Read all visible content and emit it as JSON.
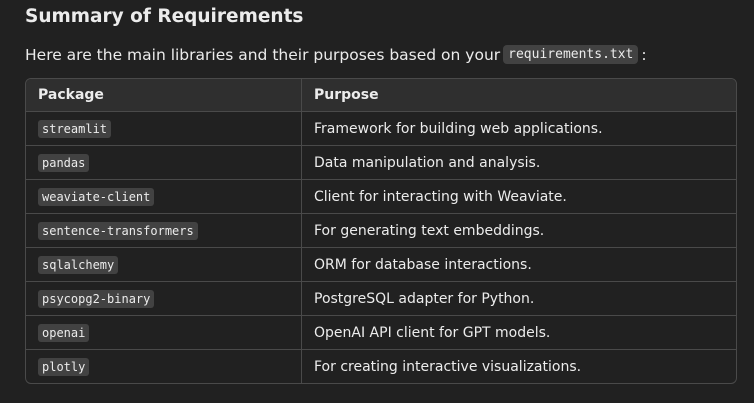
{
  "heading": "Summary of Requirements",
  "intro": {
    "before": "Here are the main libraries and their purposes based on your",
    "code": "requirements.txt",
    "after": ":"
  },
  "table": {
    "headers": {
      "package": "Package",
      "purpose": "Purpose"
    },
    "rows": [
      {
        "package": "streamlit",
        "purpose": "Framework for building web applications."
      },
      {
        "package": "pandas",
        "purpose": "Data manipulation and analysis."
      },
      {
        "package": "weaviate-client",
        "purpose": "Client for interacting with Weaviate."
      },
      {
        "package": "sentence-transformers",
        "purpose": "For generating text embeddings."
      },
      {
        "package": "sqlalchemy",
        "purpose": "ORM for database interactions."
      },
      {
        "package": "psycopg2-binary",
        "purpose": "PostgreSQL adapter for Python."
      },
      {
        "package": "openai",
        "purpose": "OpenAI API client for GPT models."
      },
      {
        "package": "plotly",
        "purpose": "For creating interactive visualizations."
      }
    ]
  }
}
